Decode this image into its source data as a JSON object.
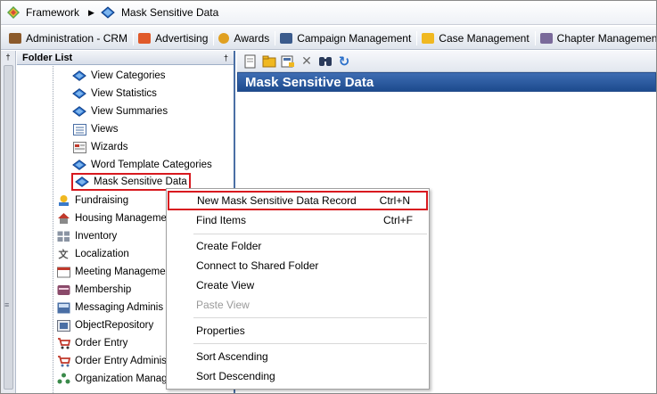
{
  "breadcrumb": {
    "items": [
      {
        "label": "Framework",
        "icon": "framework-icon"
      },
      {
        "label": "Mask Sensitive Data",
        "icon": "book-icon"
      }
    ]
  },
  "shortcuts": [
    {
      "label": "Administration - CRM",
      "icon": "briefcase-icon",
      "color": "#8b5a2b"
    },
    {
      "label": "Advertising",
      "icon": "megaphone-icon",
      "color": "#e05a2a"
    },
    {
      "label": "Awards",
      "icon": "award-icon",
      "color": "#e0a020"
    },
    {
      "label": "Campaign Management",
      "icon": "monitor-icon",
      "color": "#3b5b8c"
    },
    {
      "label": "Case Management",
      "icon": "folder-icon",
      "color": "#f0b820"
    },
    {
      "label": "Chapter Management",
      "icon": "chapter-icon",
      "color": "#7a6a9a"
    }
  ],
  "folder_list": {
    "title": "Folder List",
    "items": [
      {
        "label": "View Categories",
        "icon": "book-icon"
      },
      {
        "label": "View Statistics",
        "icon": "book-icon"
      },
      {
        "label": "View Summaries",
        "icon": "book-icon"
      },
      {
        "label": "Views",
        "icon": "list-icon"
      },
      {
        "label": "Wizards",
        "icon": "wizard-icon"
      },
      {
        "label": "Word Template Categories",
        "icon": "book-icon"
      },
      {
        "label": "Mask Sensitive Data",
        "icon": "book-icon"
      },
      {
        "label": "Fundraising",
        "icon": "fundraising-icon"
      },
      {
        "label": "Housing Manageme",
        "icon": "house-icon"
      },
      {
        "label": "Inventory",
        "icon": "inventory-icon"
      },
      {
        "label": "Localization",
        "icon": "localization-icon"
      },
      {
        "label": "Meeting Manageme",
        "icon": "calendar-icon"
      },
      {
        "label": "Membership",
        "icon": "membership-icon"
      },
      {
        "label": "Messaging Adminis",
        "icon": "messaging-icon"
      },
      {
        "label": "ObjectRepository",
        "icon": "repository-icon"
      },
      {
        "label": "Order Entry",
        "icon": "cart-icon"
      },
      {
        "label": "Order Entry Adminis",
        "icon": "cart-admin-icon"
      },
      {
        "label": "Organization Manag",
        "icon": "organization-icon"
      }
    ]
  },
  "right_panel": {
    "title": "Mask Sensitive Data",
    "toolbar": [
      "new-record-icon",
      "open-folder-icon",
      "properties-icon",
      "delete-icon",
      "find-icon",
      "refresh-icon"
    ]
  },
  "context_menu": {
    "items": [
      {
        "label": "New Mask Sensitive Data Record",
        "shortcut": "Ctrl+N"
      },
      {
        "label": "Find Items",
        "shortcut": "Ctrl+F"
      },
      {
        "label": "Create Folder",
        "shortcut": ""
      },
      {
        "label": "Connect to Shared Folder",
        "shortcut": ""
      },
      {
        "label": "Create View",
        "shortcut": ""
      },
      {
        "label": "Paste View",
        "shortcut": ""
      },
      {
        "label": "Properties",
        "shortcut": ""
      },
      {
        "label": "Sort Ascending",
        "shortcut": ""
      },
      {
        "label": "Sort Descending",
        "shortcut": ""
      }
    ]
  },
  "colors": {
    "title_bar": "#2a5a9e",
    "highlight_outline": "#d8191f"
  }
}
